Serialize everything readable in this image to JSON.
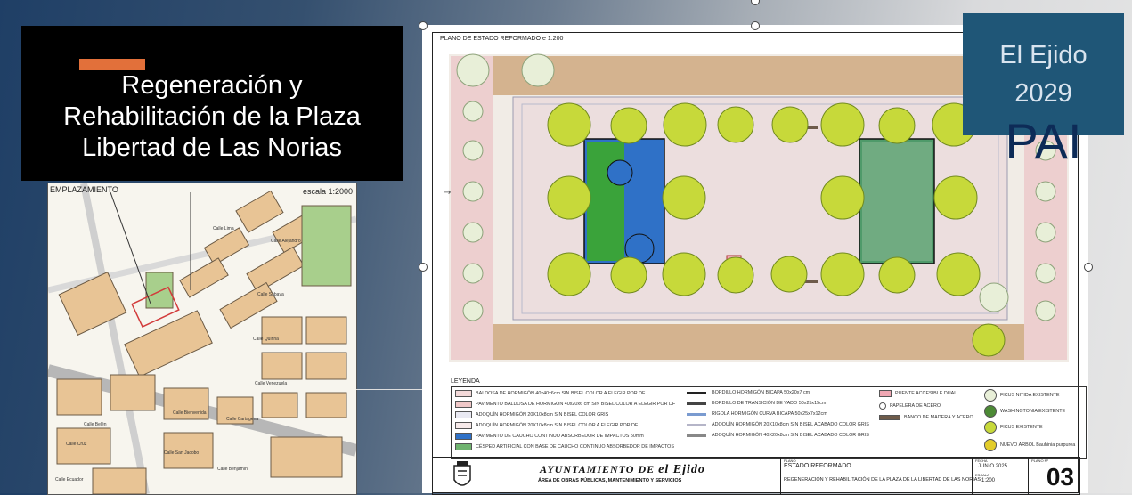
{
  "slide": {
    "title_lines": [
      "Regeneración y",
      "Rehabilitación de la Plaza",
      "Libertad de Las Norias"
    ],
    "badge": {
      "line1": "El Ejido",
      "line2": "2029",
      "big": "PAI"
    },
    "colors": {
      "accent": "#e2703a",
      "title_bg": "#000000",
      "badge_bg": "#1f5677",
      "badge_big": "#0d2b57"
    }
  },
  "location_map": {
    "header": "EMPLAZAMIENTO",
    "scale": "escala 1:2000",
    "street_labels": [
      "Calle Alejandro",
      "Calle Lima",
      "Calle Sabaya",
      "Calle Quirina",
      "Calle Venezuela",
      "Calle Bienvenida",
      "Calle Cartagena",
      "Calle Belén",
      "Calle Cruz",
      "Calle Benjamín",
      "Calle San Jacobo",
      "Calle Ecuador"
    ]
  },
  "plan": {
    "title": "PLANO DE ESTADO REFORMADO e 1:200",
    "legend_title": "LEYENDA",
    "legend_col1": [
      "BALDOSA DE HORMIGÓN 40x40x6cm SIN BISEL COLOR A ELEGIR POR DF",
      "PAVIMENTO BALDOSA DE HORMIGÓN 40x20x6 cm SIN BISEL COLOR A ELEGIR POR DF",
      "ADOQUÍN HORMIGÓN 20X10x8cm SIN BISEL COLOR GRIS",
      "ADOQUÍN HORMIGÓN 20X10x8cm SIN BISEL COLOR A ELEGIR POR DF",
      "PAVIMENTO DE CAUCHO CONTINUO ABSORBEDOR DE IMPACTOS 50mm",
      "CÉSPED ARTIFICIAL CON BASE DE CAUCHO CONTINUO ABSORBEDOR DE IMPACTOS"
    ],
    "legend_col2": [
      "BORDILLO HORMIGÓN BICAPA 50x20x7 cm",
      "BORDILLO DE TRANSICIÓN DE VADO 50x25x15cm",
      "RIGOLA HORMIGÓN CURVA BICAPA 50x25x7x12cm",
      "ADOQUÍN HORMIGÓN 20X10x8cm SIN BISEL ACABADO COLOR GRIS",
      "ADOQUÍN HORMIGÓN 40X20x8cm SIN BISEL ACABADO COLOR GRIS"
    ],
    "legend_col3": [
      "PUENTE ACCESIBLE DUAL",
      "PAPELERA DE ACERO",
      "BANCO DE MADERA Y ACERO"
    ],
    "legend_col4": [
      "FICUS NITIDA EXISTENTE",
      "WASHINGTONIA EXISTENTE",
      "FICUS EXISTENTE",
      "NUEVO ÁRBOL Bauhinia purpurea"
    ],
    "title_block": {
      "ayuntamiento": "AYUNTAMIENTO DE",
      "signature": "el Ejido",
      "area": "ÁREA DE OBRAS PÚBLICAS, MANTENIMIENTO Y SERVICIOS",
      "plano_label": "PLANO",
      "plano": "ESTADO REFORMADO",
      "proyecto": "REGENERACIÓN Y REHABILITACIÓN DE LA PLAZA DE LA LIBERTAD DE LAS NORIAS",
      "fecha_label": "FECHA",
      "fecha": "JUNIO 2025",
      "escala_label": "ESCALA",
      "escala": "1:200",
      "plano_n_label": "PLANO Nº",
      "sheet": "03"
    }
  }
}
